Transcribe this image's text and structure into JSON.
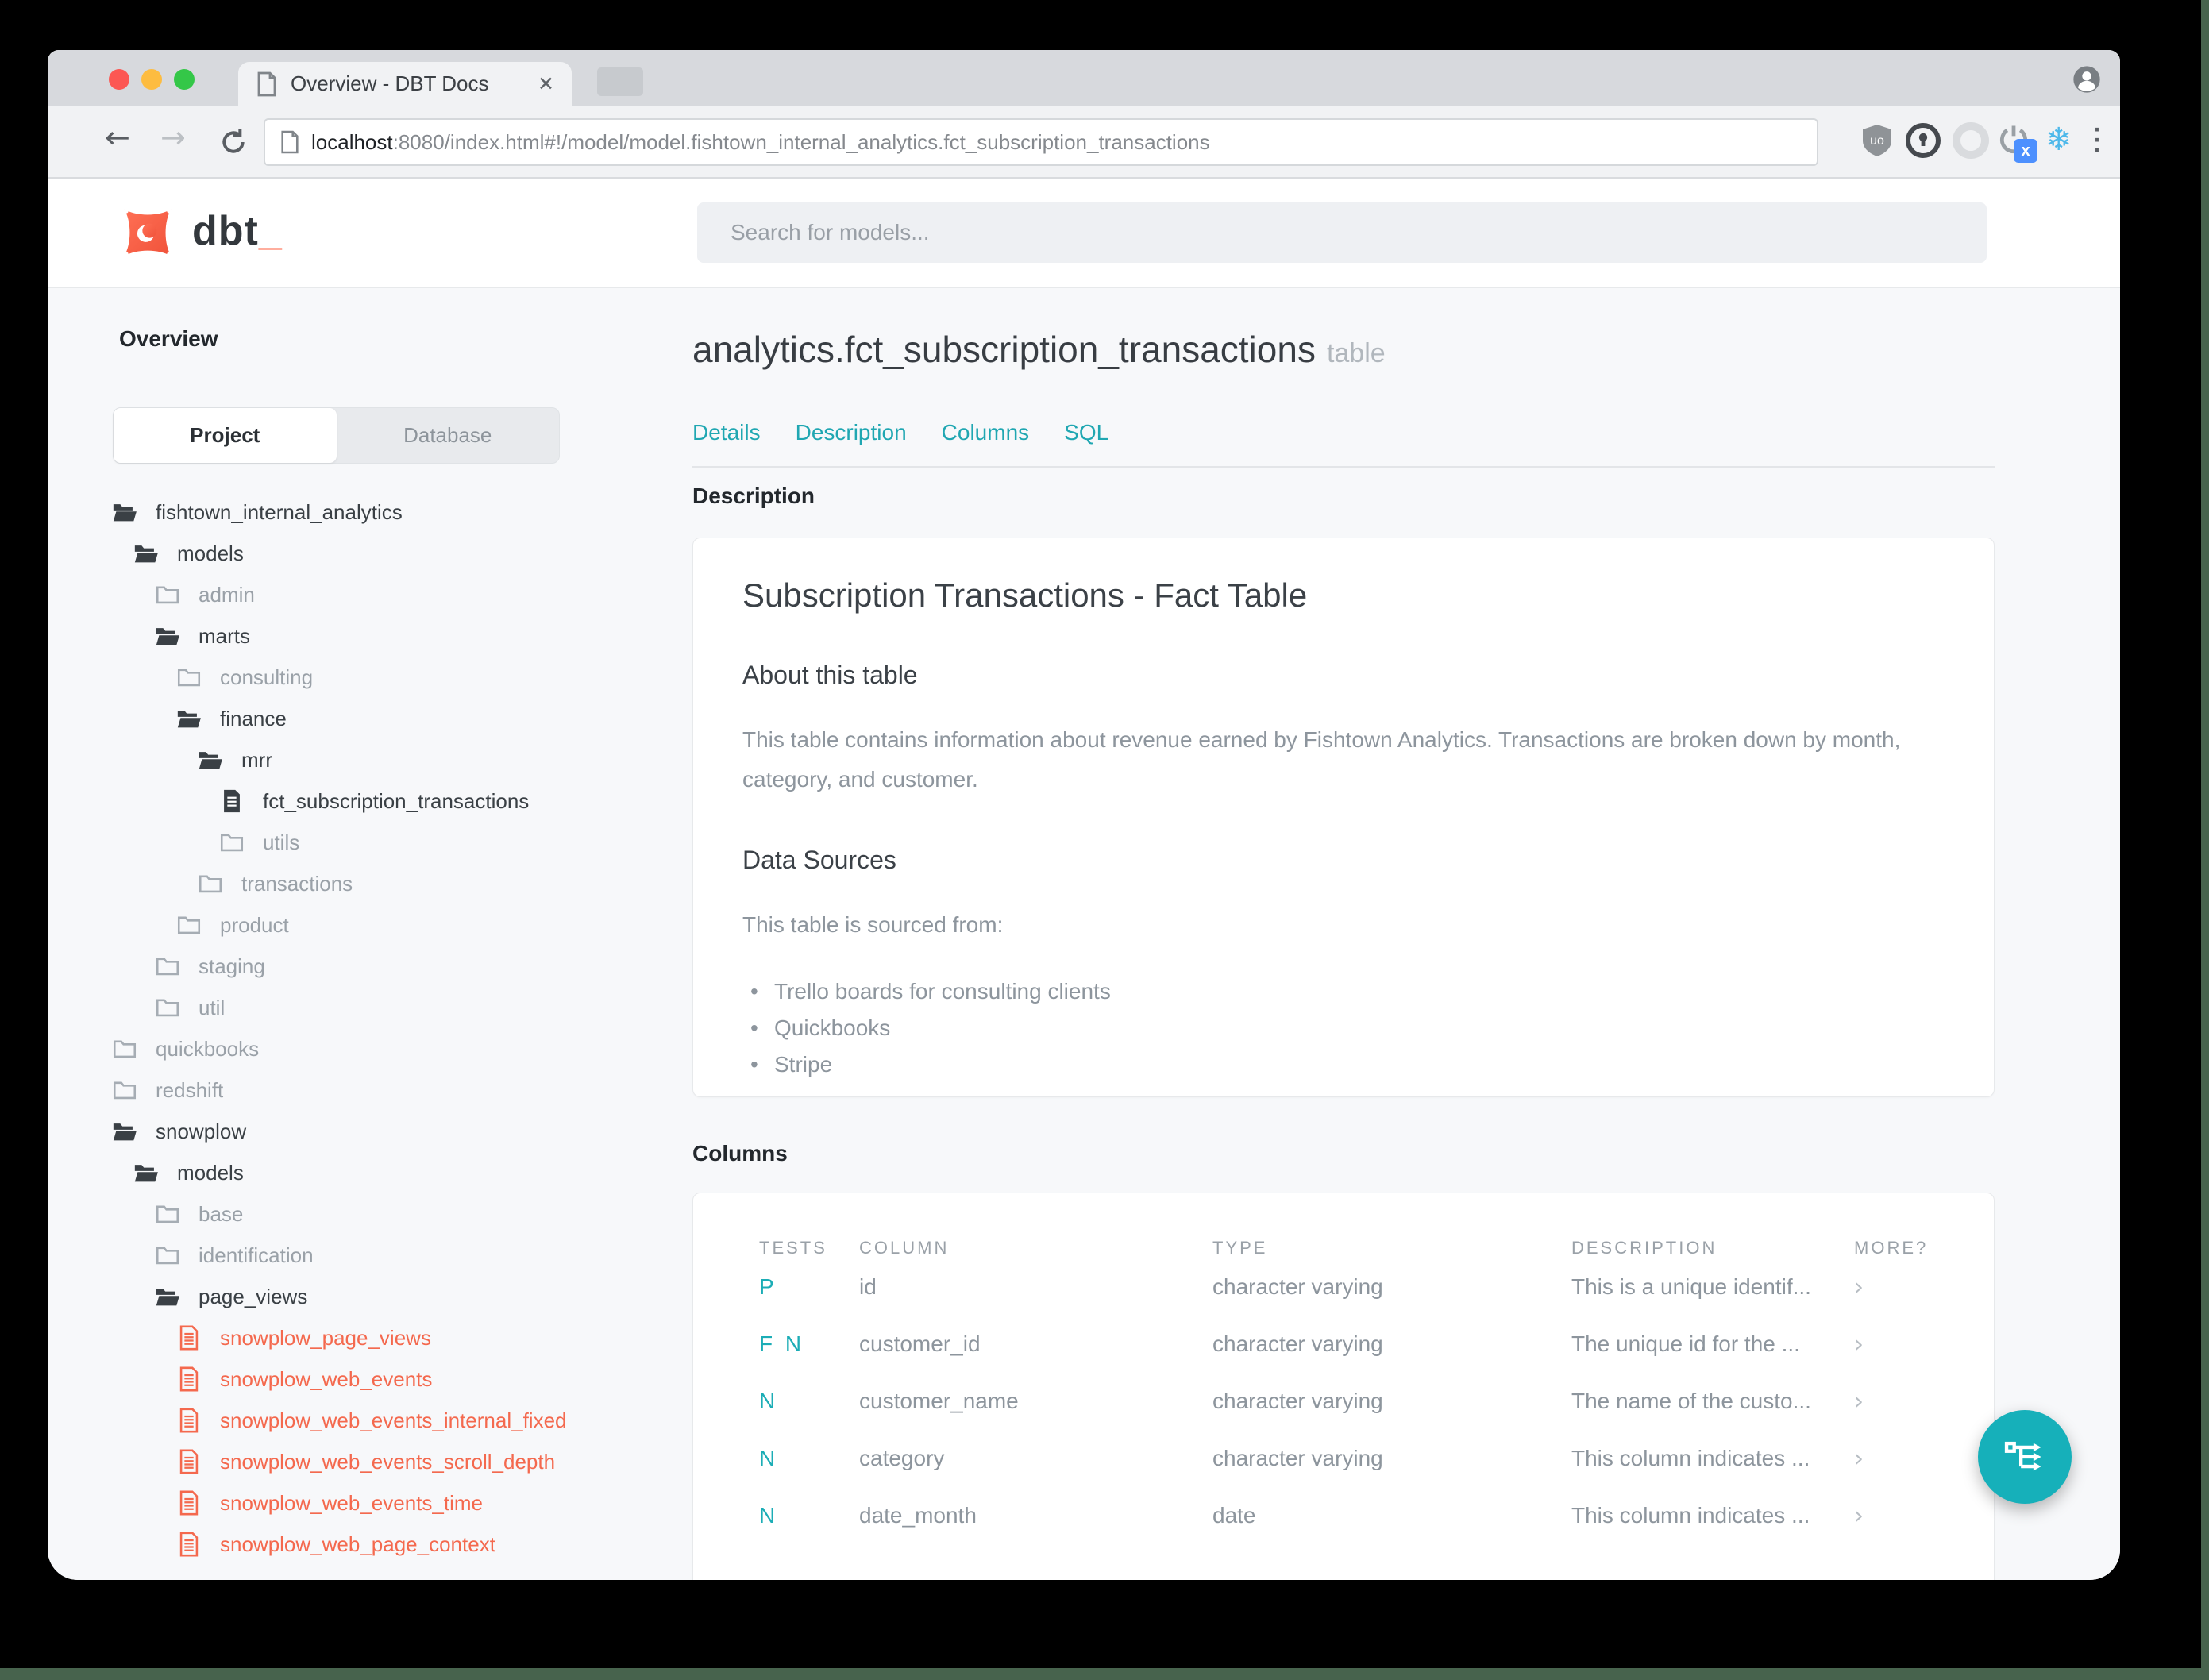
{
  "browser": {
    "tab_title": "Overview - DBT Docs",
    "tab_close": "✕",
    "url_host": "localhost",
    "url_rest": ":8080/index.html#!/model/model.fishtown_internal_analytics.fct_subscription_transactions",
    "back": "←",
    "forward": "→",
    "menu_dots": "⋮",
    "snowflake": "❄",
    "power_badge": "x"
  },
  "site": {
    "logo_text": "dbt",
    "logo_underscore": "_",
    "search_placeholder": "Search for models..."
  },
  "sidebar": {
    "heading": "Overview",
    "tab_project": "Project",
    "tab_database": "Database",
    "tree": [
      {
        "label": "fishtown_internal_analytics",
        "level": 0,
        "type": "folder-open"
      },
      {
        "label": "models",
        "level": 1,
        "type": "folder-open"
      },
      {
        "label": "admin",
        "level": 2,
        "type": "folder"
      },
      {
        "label": "marts",
        "level": 2,
        "type": "folder-open"
      },
      {
        "label": "consulting",
        "level": 3,
        "type": "folder"
      },
      {
        "label": "finance",
        "level": 3,
        "type": "folder-open"
      },
      {
        "label": "mrr",
        "level": 4,
        "type": "folder-open"
      },
      {
        "label": "fct_subscription_transactions",
        "level": 5,
        "type": "file",
        "selected": true
      },
      {
        "label": "utils",
        "level": 5,
        "type": "folder"
      },
      {
        "label": "transactions",
        "level": 4,
        "type": "folder"
      },
      {
        "label": "product",
        "level": 3,
        "type": "folder"
      },
      {
        "label": "staging",
        "level": 2,
        "type": "folder"
      },
      {
        "label": "util",
        "level": 2,
        "type": "folder"
      },
      {
        "label": "quickbooks",
        "level": 0,
        "type": "folder"
      },
      {
        "label": "redshift",
        "level": 0,
        "type": "folder"
      },
      {
        "label": "snowplow",
        "level": 0,
        "type": "folder-open"
      },
      {
        "label": "models",
        "level": 1,
        "type": "folder-open"
      },
      {
        "label": "base",
        "level": 2,
        "type": "folder"
      },
      {
        "label": "identification",
        "level": 2,
        "type": "folder"
      },
      {
        "label": "page_views",
        "level": 2,
        "type": "folder-open"
      },
      {
        "label": "snowplow_page_views",
        "level": 3,
        "type": "file-red"
      },
      {
        "label": "snowplow_web_events",
        "level": 3,
        "type": "file-red"
      },
      {
        "label": "snowplow_web_events_internal_fixed",
        "level": 3,
        "type": "file-red"
      },
      {
        "label": "snowplow_web_events_scroll_depth",
        "level": 3,
        "type": "file-red"
      },
      {
        "label": "snowplow_web_events_time",
        "level": 3,
        "type": "file-red"
      },
      {
        "label": "snowplow_web_page_context",
        "level": 3,
        "type": "file-red"
      }
    ]
  },
  "main": {
    "title": "analytics.fct_subscription_transactions",
    "title_badge": "table",
    "nav": [
      "Details",
      "Description",
      "Columns",
      "SQL"
    ],
    "description_heading": "Description",
    "card": {
      "title": "Subscription Transactions - Fact Table",
      "about_heading": "About this table",
      "about_text": "This table contains information about revenue earned by Fishtown Analytics. Transactions are broken down by month, category, and customer.",
      "sources_heading": "Data Sources",
      "sources_intro": "This table is sourced from:",
      "sources": [
        "Trello boards for consulting clients",
        "Quickbooks",
        "Stripe"
      ]
    },
    "columns_heading": "Columns",
    "table": {
      "headers": [
        "TESTS",
        "COLUMN",
        "TYPE",
        "DESCRIPTION",
        "MORE?"
      ],
      "rows": [
        {
          "tests": "P",
          "column": "id",
          "type": "character varying",
          "description": "This is a unique identif...",
          "more": "›"
        },
        {
          "tests": "F N",
          "column": "customer_id",
          "type": "character varying",
          "description": "The unique id for the ...",
          "more": "›"
        },
        {
          "tests": "N",
          "column": "customer_name",
          "type": "character varying",
          "description": "The name of the custo...",
          "more": "›"
        },
        {
          "tests": "N",
          "column": "category",
          "type": "character varying",
          "description": "This column indicates ...",
          "more": "›"
        },
        {
          "tests": "N",
          "column": "date_month",
          "type": "date",
          "description": "This column indicates ...",
          "more": "›"
        }
      ]
    }
  },
  "colors": {
    "teal": "#1cadb6",
    "brand_orange": "#ff5c3c",
    "file_red": "#f4694e"
  }
}
